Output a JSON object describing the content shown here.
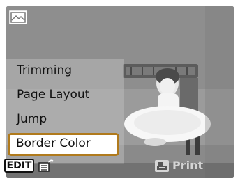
{
  "menu": {
    "items": [
      {
        "label": "Trimming"
      },
      {
        "label": "Page Layout"
      },
      {
        "label": "Jump"
      },
      {
        "label": "Border Color"
      }
    ],
    "selected_index": 3
  },
  "bottom_bar": {
    "edit_label": "EDIT",
    "print_label": "Print"
  },
  "icons": {
    "top_left": "photo-mode-icon",
    "edit_extra": "list-icon",
    "print": "print-icon"
  },
  "colors": {
    "selection_border": "#b07a1c",
    "print_label": "#d4d4d4"
  }
}
